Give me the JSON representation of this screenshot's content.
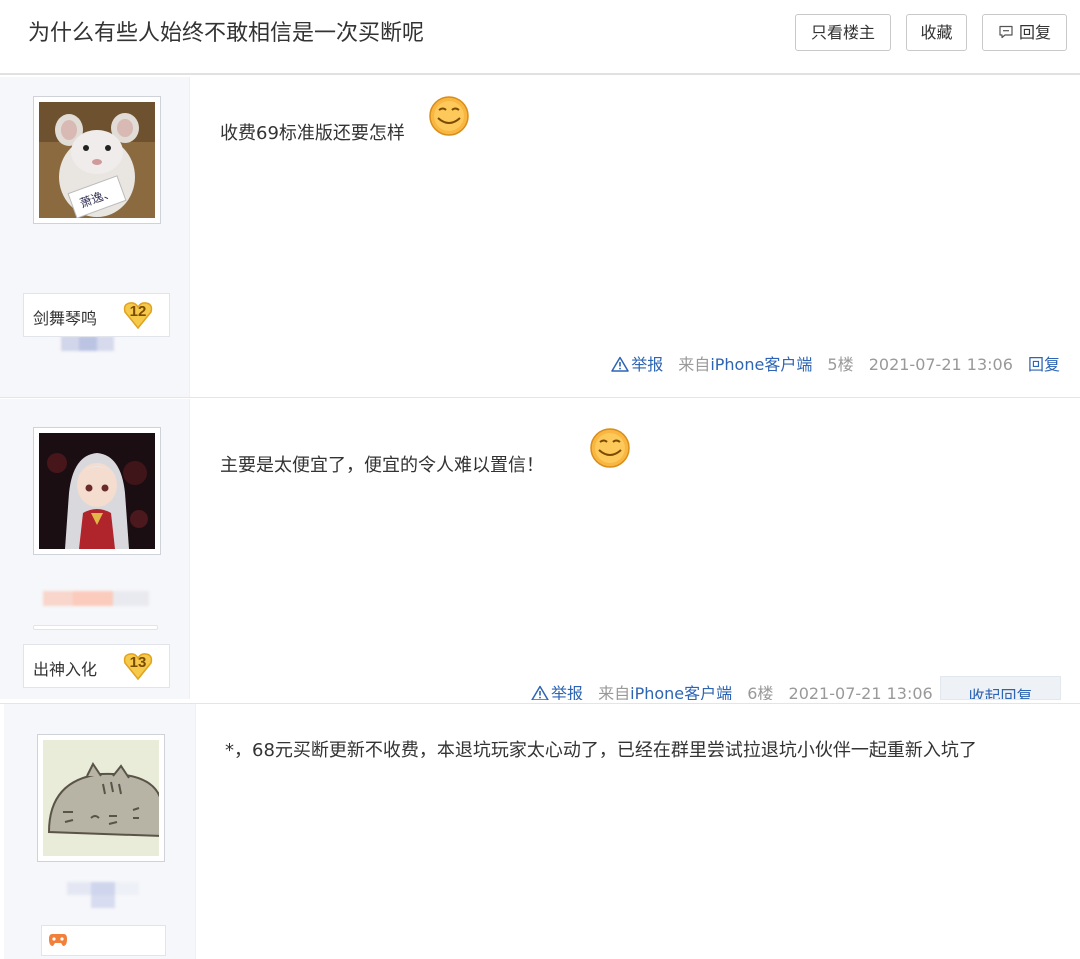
{
  "header": {
    "title": "为什么有些人始终不敢相信是一次买断呢",
    "only_op_label": "只看楼主",
    "favorite_label": "收藏",
    "reply_label": "回复"
  },
  "posts": [
    {
      "level_name": "剑舞琴鸣",
      "level": "12",
      "content": "收费69标准版还要怎样",
      "report_label": "举报",
      "source_prefix": "来自",
      "source_client": "iPhone客户端",
      "floor": "5楼",
      "time": "2021-07-21 13:06",
      "reply_label": "回复"
    },
    {
      "level_name": "出神入化",
      "level": "13",
      "content": "主要是太便宜了，便宜的令人难以置信！",
      "report_label": "举报",
      "source_prefix": "来自",
      "source_client": "iPhone客户端",
      "floor": "6楼",
      "time": "2021-07-21 13:06",
      "collapse_label": "收起回复"
    },
    {
      "content": "*，68元买断更新不收费，本退坑玩家太心动了，已经在群里尝试拉退坑小伙伴一起重新入坑了"
    }
  ],
  "colors": {
    "link": "#2d64b3",
    "meta": "#999999",
    "sidebar": "#f6f7fa"
  }
}
